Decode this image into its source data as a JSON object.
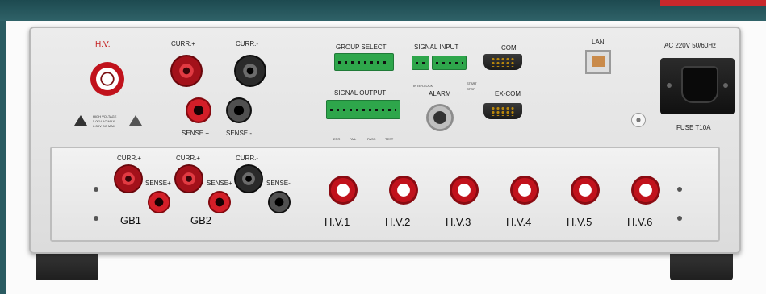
{
  "top_panel": {
    "hv_label": "H.V.",
    "curr_plus": "CURR.+",
    "curr_minus": "CURR.-",
    "sense_plus": "SENSE.+",
    "sense_minus": "SENSE.-",
    "warning_line1": "HIGH VOLTAGE",
    "warning_line2": "5.0KV AC MAX",
    "warning_line3": "6.0KV DC MAX",
    "group_select": "GROUP SELECT",
    "signal_input": "SIGNAL INPUT",
    "signal_output": "SIGNAL OUTPUT",
    "interlock": "INTER-LOCK",
    "start": "START",
    "stop": "STOP",
    "out_labels": [
      "ERR",
      "FAIL",
      "PASS",
      "TEST"
    ],
    "com": "COM",
    "ex_com": "EX-COM",
    "alarm": "ALARM",
    "lan": "LAN",
    "power_rating": "AC 220V 50/60Hz",
    "fuse": "FUSE  T10A"
  },
  "bottom_panel": {
    "gb1": "GB1",
    "gb2": "GB2",
    "gb_curr_plus": "CURR.+",
    "gb_sense_plus": "SENSE+",
    "gb_curr_minus": "CURR.-",
    "gb_sense_minus": "SENSE-",
    "hv_outputs": [
      "H.V.1",
      "H.V.2",
      "H.V.3",
      "H.V.4",
      "H.V.5",
      "H.V.6"
    ]
  },
  "colors": {
    "background": "#2a5b61",
    "accent_red": "#c8282c",
    "terminal_green": "#2ea64b"
  }
}
